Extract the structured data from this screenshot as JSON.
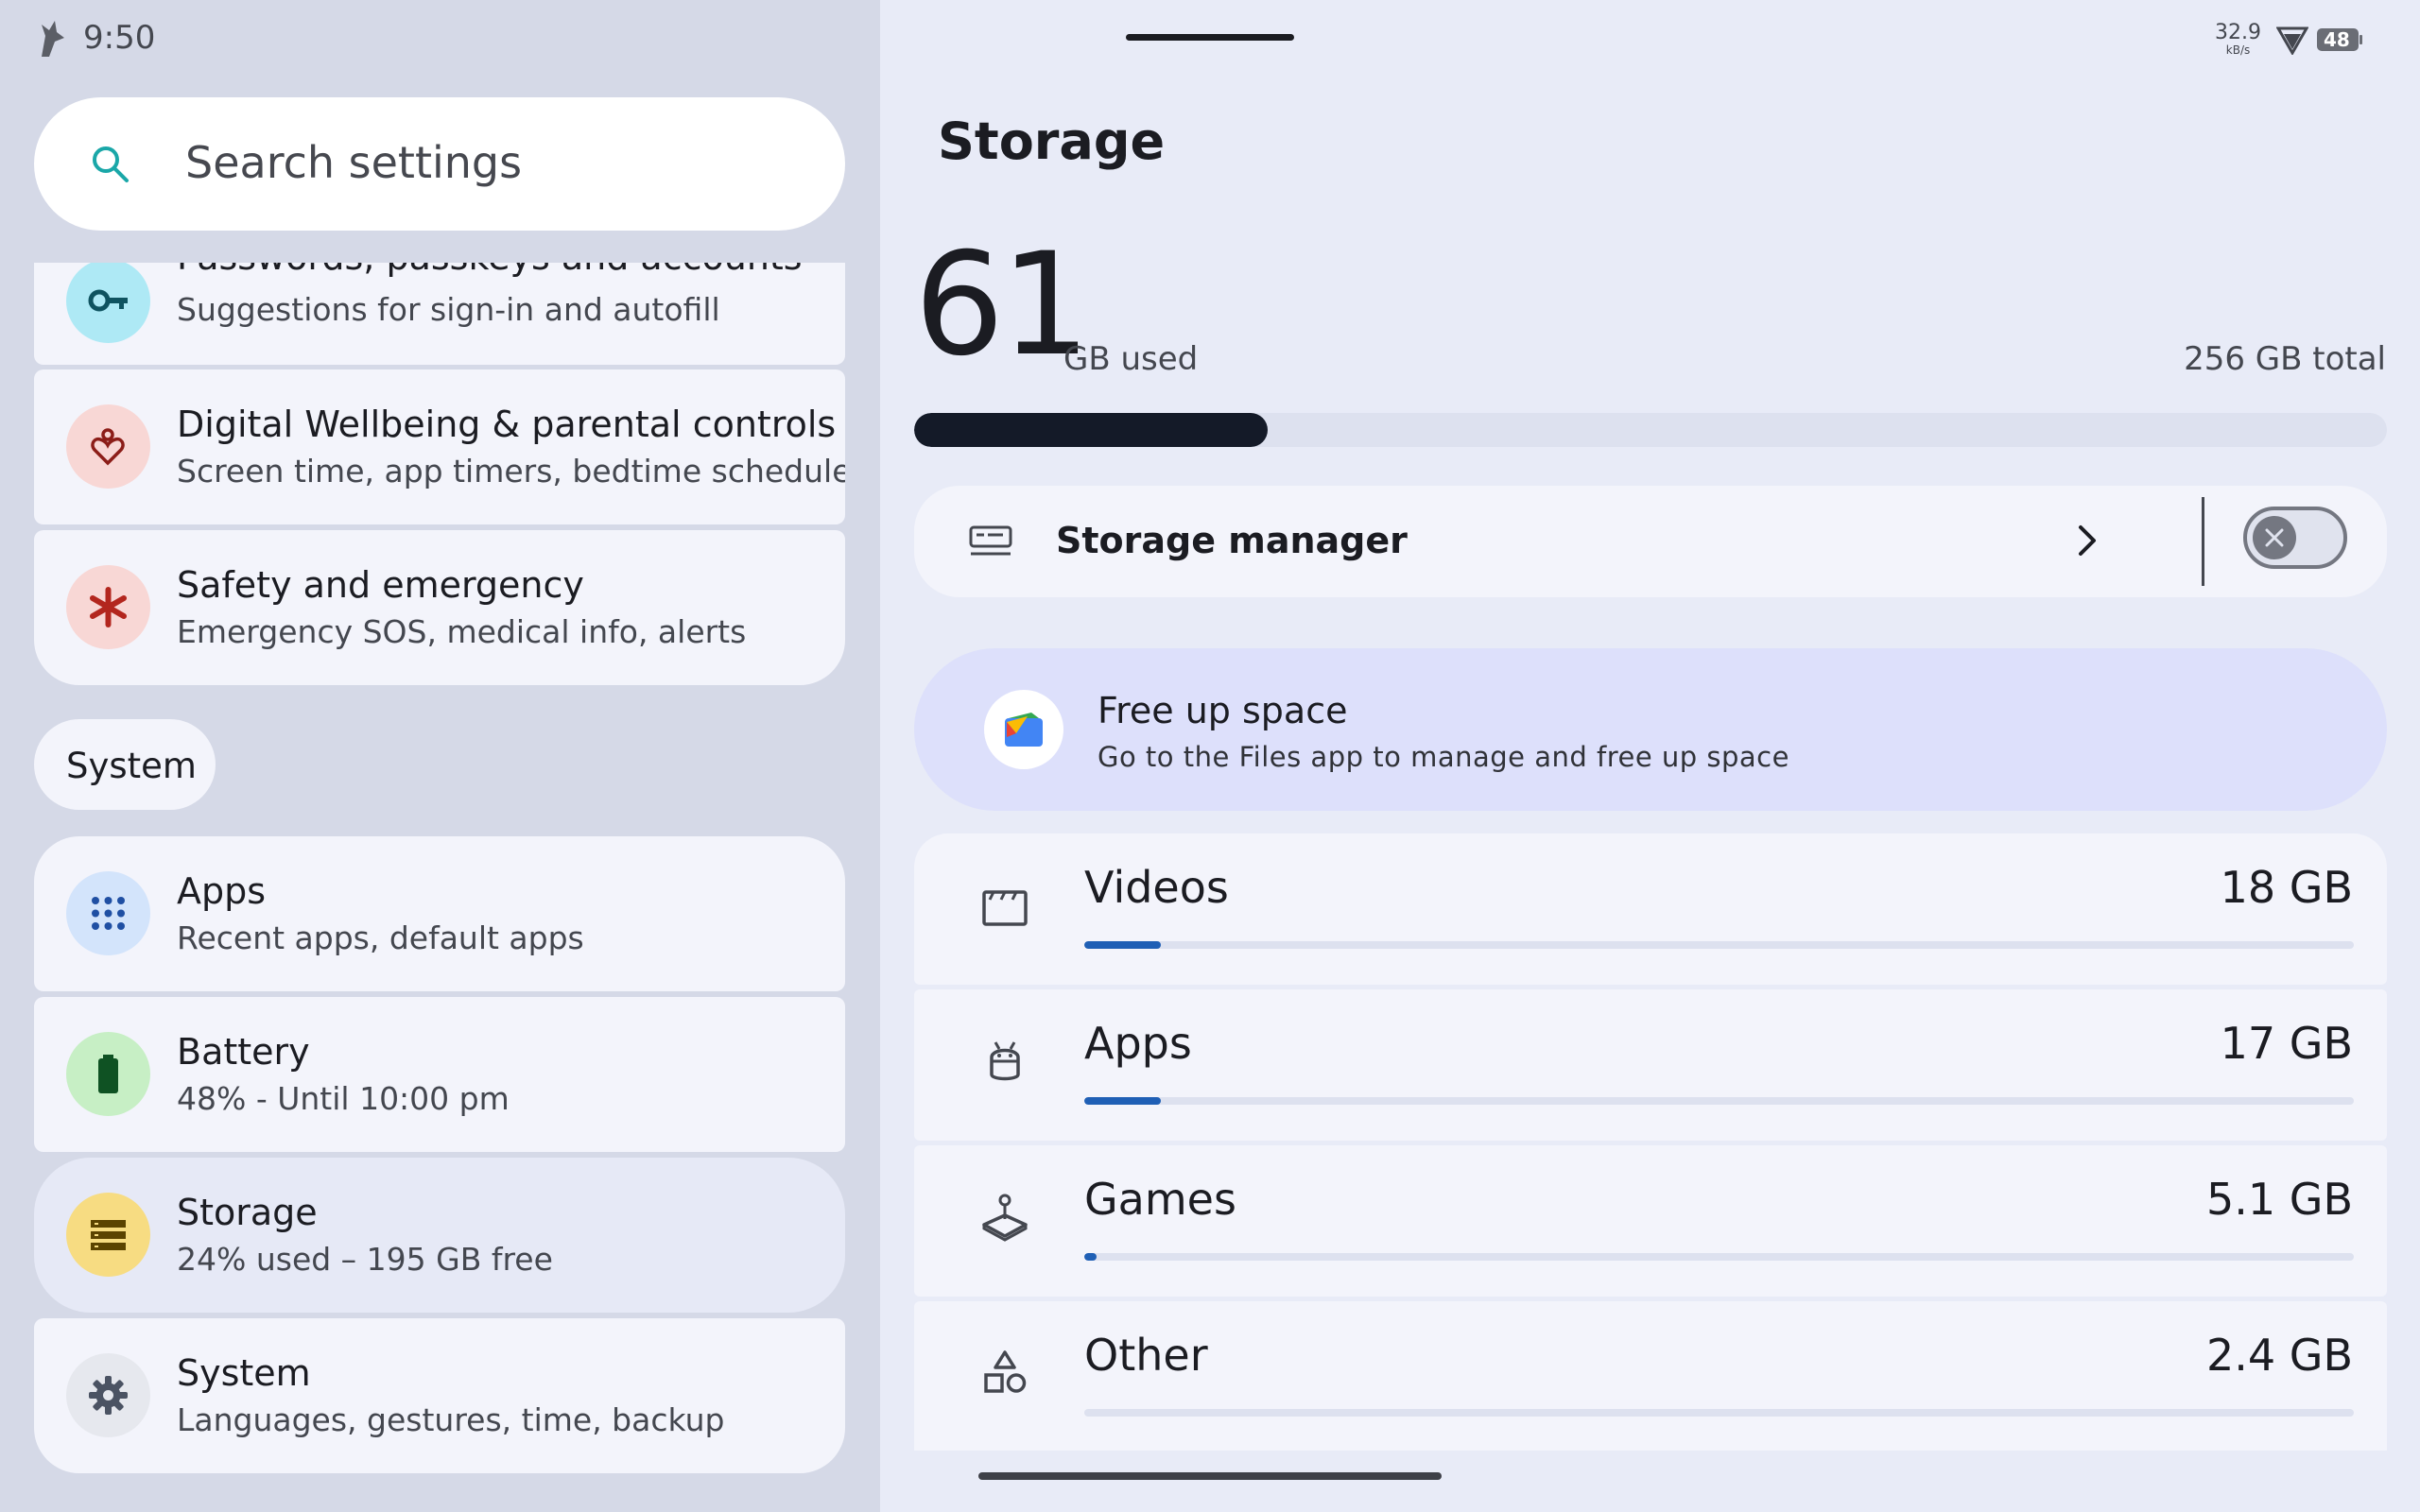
{
  "status_bar": {
    "time": "9:50",
    "net_speed_value": "32.9",
    "net_speed_unit": "kB/s",
    "battery_level": "48"
  },
  "search": {
    "placeholder": "Search settings"
  },
  "settings_list": [
    {
      "title": "Passwords, passkeys and accounts",
      "subtitle": "Suggestions for sign-in and autofill",
      "icon": "key-icon",
      "color": "#aee9f5"
    },
    {
      "title": "Digital Wellbeing & parental controls",
      "subtitle": "Screen time, app timers, bedtime schedules",
      "icon": "heart-person-icon",
      "color": "#f8d7d5"
    },
    {
      "title": "Safety and emergency",
      "subtitle": "Emergency SOS, medical info, alerts",
      "icon": "asterisk-icon",
      "color": "#f8d7d5"
    }
  ],
  "system_section": {
    "header": "System",
    "items": [
      {
        "title": "Apps",
        "subtitle": "Recent apps, default apps",
        "icon": "apps-grid-icon",
        "color": "#d3e4fb"
      },
      {
        "title": "Battery",
        "subtitle": "48% - Until 10:00 pm",
        "icon": "battery-icon",
        "color": "#c7efc5"
      },
      {
        "title": "Storage",
        "subtitle": "24% used – 195 GB free",
        "icon": "storage-icon",
        "color": "#f7dc82",
        "selected": true
      },
      {
        "title": "System",
        "subtitle": "Languages, gestures, time, backup",
        "icon": "gear-icon",
        "color": "#e6e8ee"
      }
    ]
  },
  "storage": {
    "title": "Storage",
    "used_value": "61",
    "used_label": "GB used",
    "total_label": "256 GB total",
    "used_fraction": 0.24,
    "manager_label": "Storage manager",
    "manager_enabled": false,
    "free_up_title": "Free up space",
    "free_up_subtitle": "Go to the Files app to manage and free up space",
    "categories": [
      {
        "name": "Videos",
        "size": "18 GB",
        "fraction": 0.06,
        "icon": "video-icon"
      },
      {
        "name": "Apps",
        "size": "17 GB",
        "fraction": 0.06,
        "icon": "android-icon"
      },
      {
        "name": "Games",
        "size": "5.1 GB",
        "fraction": 0.01,
        "icon": "joystick-icon"
      },
      {
        "name": "Other",
        "size": "2.4 GB",
        "fraction": 0.0,
        "icon": "shapes-icon"
      }
    ]
  }
}
